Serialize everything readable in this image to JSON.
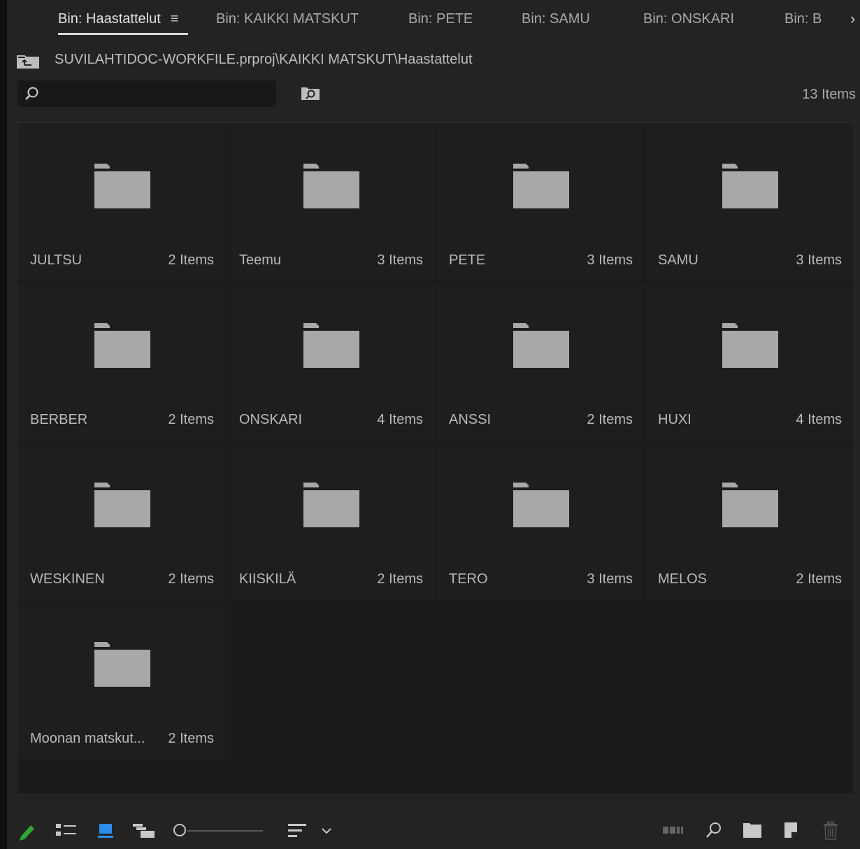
{
  "tabs": [
    {
      "label": "Bin: Haastattelut",
      "active": true
    },
    {
      "label": "Bin: KAIKKI MATSKUT"
    },
    {
      "label": "Bin: PETE"
    },
    {
      "label": "Bin: SAMU"
    },
    {
      "label": "Bin: ONSKARI"
    },
    {
      "label": "Bin: B"
    }
  ],
  "tab_menu_icon": "≡",
  "tab_overflow_icon": "›",
  "breadcrumb": {
    "path": "SUVILAHTIDOC-WORKFILE.prproj\\KAIKKI MATSKUT\\Haastattelut"
  },
  "search": {
    "value": "",
    "placeholder": ""
  },
  "item_count": "13 Items",
  "bins": [
    {
      "name": "JULTSU",
      "count": "2 Items"
    },
    {
      "name": "Teemu",
      "count": "3 Items"
    },
    {
      "name": "PETE",
      "count": "3 Items"
    },
    {
      "name": "SAMU",
      "count": "3 Items"
    },
    {
      "name": "BERBER",
      "count": "2 Items"
    },
    {
      "name": "ONSKARI",
      "count": "4 Items"
    },
    {
      "name": "ANSSI",
      "count": "2 Items"
    },
    {
      "name": "HUXI",
      "count": "4 Items"
    },
    {
      "name": "WESKINEN",
      "count": "2 Items"
    },
    {
      "name": "KIISKILÄ",
      "count": "2 Items"
    },
    {
      "name": "TERO",
      "count": "3 Items"
    },
    {
      "name": "MELOS",
      "count": "2 Items"
    },
    {
      "name": "Moonan matskut...",
      "count": "2 Items"
    }
  ],
  "colors": {
    "panel_bg": "#232323",
    "folder": "#a8a8a8",
    "pencil_accent": "#2fa82f",
    "icon_view_accent": "#2d8ceb"
  },
  "toolbar": {
    "icons": [
      "pencil-icon",
      "list-view-icon",
      "icon-view-icon",
      "freeform-view-icon",
      "zoom-slider",
      "sort-icon",
      "automate-to-sequence-icon",
      "find-icon",
      "new-bin-icon",
      "new-item-icon",
      "trash-icon"
    ]
  }
}
